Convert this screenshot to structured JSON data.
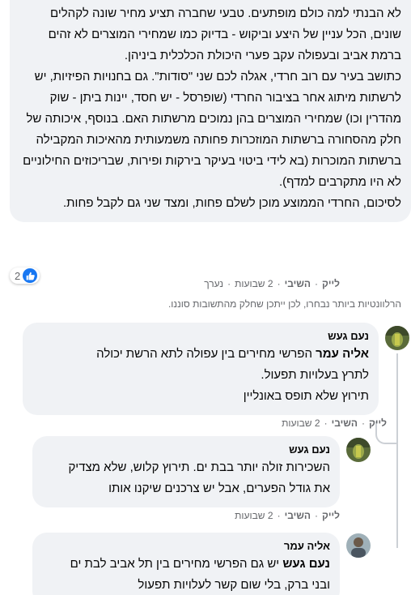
{
  "main_comment": {
    "paragraphs": [
      "לא הבנתי למה כולם מופתעים. טבעי שחברה תציע מחיר שונה לקהלים שונים, הכל עניין של היצע וביקוש - בדיוק כמו שמחירי המוצרים לא זהים ברמת אביב ובעפולה עקב פערי היכולת הכלכלית ביניהן.",
      "כתושב בעיר עם רוב חרדי, אגלה לכם שני \"סודות\". גם בחנויות הפיזיות, יש לרשתות מיתוג אחר בציבור החרדי (שופרסל - יש חסד, יינות ביתן - שוק מהדרין וכו) שמחירי המוצרים בהן נמוכים מרשתות האם. בנוסף, איכותה של חלק מהסחורה ברשתות המוזכרות פחותה משמעותית מהאיכות המקבילה ברשתות המוכרות (בא לידי ביטוי בעיקר בירקות ופירות, שבריכוזים החילוניים לא היו מתקרבים למדף).",
      "לסיכום, החרדי הממוצע מוכן לשלם פחות, ומצד שני גם לקבל פחות."
    ],
    "reaction_count": "2",
    "actions": {
      "like": "לייק",
      "reply": "השיבי",
      "time": "2 שבועות",
      "edited": "נערך"
    }
  },
  "notice": "הרלוונטיות ביותר נבחרו, לכן ייתכן שחלק מהתשובות סוננו.",
  "replies": [
    {
      "author": "נעם געש",
      "mention": "אליה עמר",
      "lines": [
        "הפרשי מחירים בין עפולה לתא הרשת יכולה",
        "לתרץ בעלויות תפעול.",
        "תירוץ שלא תופס באונליין"
      ],
      "actions": {
        "like": "לייק",
        "reply": "השיבי",
        "time": "2 שבועות"
      }
    },
    {
      "author": "נעם געש",
      "lines": [
        "השכירות זולה יותר בבת ים. תירוץ קלוש, שלא מצדיק",
        "את גודל הפערים, אבל יש צרכנים שיקנו אותו"
      ],
      "actions": {
        "like": "לייק",
        "reply": "השיבי",
        "time": "2 שבועות"
      }
    },
    {
      "author": "אליה עמר",
      "mention": "נעם געש",
      "lines": [
        "יש גם הפרשי מחירים בין תל אביב לבת ים",
        "ובני ברק, בלי שום קשר לעלויות תפעול"
      ]
    }
  ]
}
